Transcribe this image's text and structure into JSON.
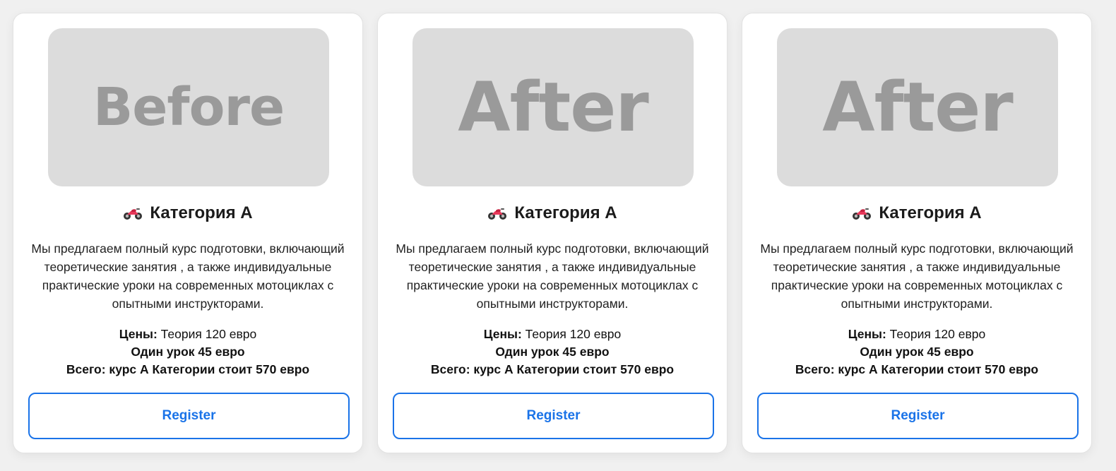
{
  "accent_color": "#1a73e8",
  "cards": [
    {
      "image_label": "Before",
      "icon": "motorcycle-icon",
      "title": "Категория А",
      "description": "Мы предлагаем полный курс подготовки, включающий теоретические занятия , а также индивидуальные практические уроки на современных мотоциклах с опытными инструкторами.",
      "prices_label": "Цены:",
      "prices_theory": " Теория 120 евро",
      "lesson_price": "Один урок 45 евро",
      "total": "Всего: курс А Категории стоит 570 евро",
      "button_label": "Register"
    },
    {
      "image_label": "After",
      "icon": "motorcycle-icon",
      "title": "Категория А",
      "description": "Мы предлагаем полный курс подготовки, включающий теоретические занятия , а также индивидуальные практические уроки на современных мотоциклах с опытными инструкторами.",
      "prices_label": "Цены:",
      "prices_theory": " Теория 120 евро",
      "lesson_price": "Один урок 45 евро",
      "total": "Всего: курс А Категории стоит 570 евро",
      "button_label": "Register"
    },
    {
      "image_label": "After",
      "icon": "motorcycle-icon",
      "title": "Категория А",
      "description": "Мы предлагаем полный курс подготовки, включающий теоретические занятия , а также индивидуальные практические уроки на современных мотоциклах с опытными инструкторами.",
      "prices_label": "Цены:",
      "prices_theory": " Теория 120 евро",
      "lesson_price": "Один урок 45 евро",
      "total": "Всего: курс А Категории стоит 570 евро",
      "button_label": "Register"
    }
  ]
}
